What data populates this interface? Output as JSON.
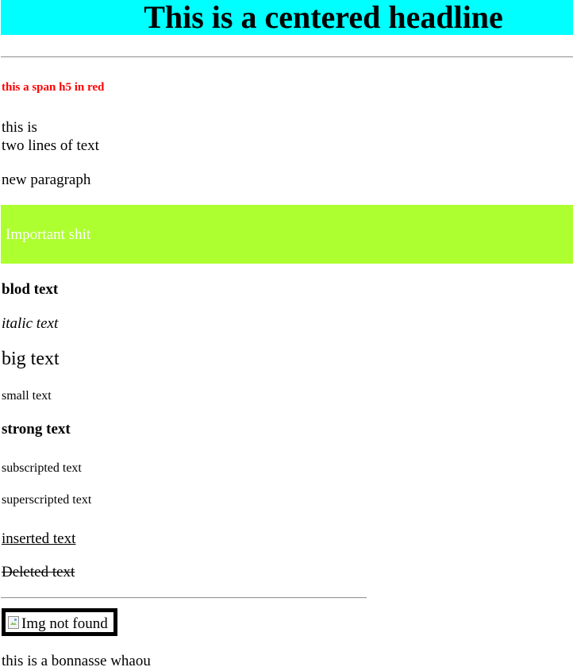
{
  "header": {
    "headline": "This is a centered headline",
    "background_color": "#00ffff"
  },
  "content": {
    "red_heading": "this a span h5 in red",
    "red_heading_color": "#ff0000",
    "paragraph_line_1": "this is",
    "paragraph_line_2": "two lines of text",
    "new_paragraph": "new paragraph",
    "important_text": "Important shit",
    "important_background": "#adff2f",
    "bold_text": "blod text",
    "italic_text": "italic text",
    "big_text": "big text",
    "small_text": "small text",
    "strong_text": "strong text",
    "subscripted_text": "subscripted text",
    "superscripted_text": "superscripted text",
    "inserted_text": "inserted text",
    "deleted_text": "Deleted text",
    "image_alt": "Img not found",
    "broken_image_icon": "broken-image-icon",
    "final_text": "this is a bonnasse whaou"
  }
}
